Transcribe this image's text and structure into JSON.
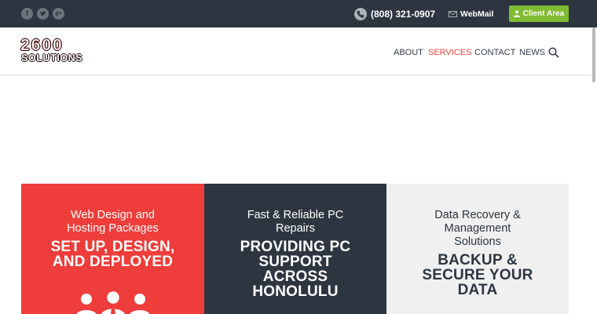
{
  "topbar": {
    "social": [
      "facebook-icon",
      "twitter-icon",
      "google-plus-icon"
    ],
    "phone": "(808) 321-0907",
    "webmail": "WebMail",
    "client_area": "Client Area"
  },
  "header": {
    "logo_top": "2600",
    "logo_bottom": "SOLUTIONS",
    "nav": [
      "ABOUT",
      "SERVICES",
      "CONTACT",
      "NEWS"
    ],
    "active_nav": "SERVICES"
  },
  "panels": [
    {
      "sub": [
        "Web Design and",
        "Hosting Packages"
      ],
      "big": [
        "SET UP, DESIGN,",
        "AND DEPLOYED"
      ]
    },
    {
      "sub": [
        "Fast & Reliable PC",
        "Repairs"
      ],
      "big": [
        "PROVIDING PC",
        "SUPPORT",
        "ACROSS",
        "HONOLULU"
      ]
    },
    {
      "sub": [
        "Data Recovery &",
        "Management",
        "Solutions"
      ],
      "big": [
        "BACKUP &",
        "SECURE YOUR",
        "DATA"
      ]
    }
  ],
  "colors": {
    "topbar": "#2d3640",
    "accent_red": "#ee3d3a",
    "nav_active": "#e74341",
    "client_green": "#80bb31",
    "panel_dark": "#2d3640",
    "panel_light": "#f0f0f0"
  }
}
